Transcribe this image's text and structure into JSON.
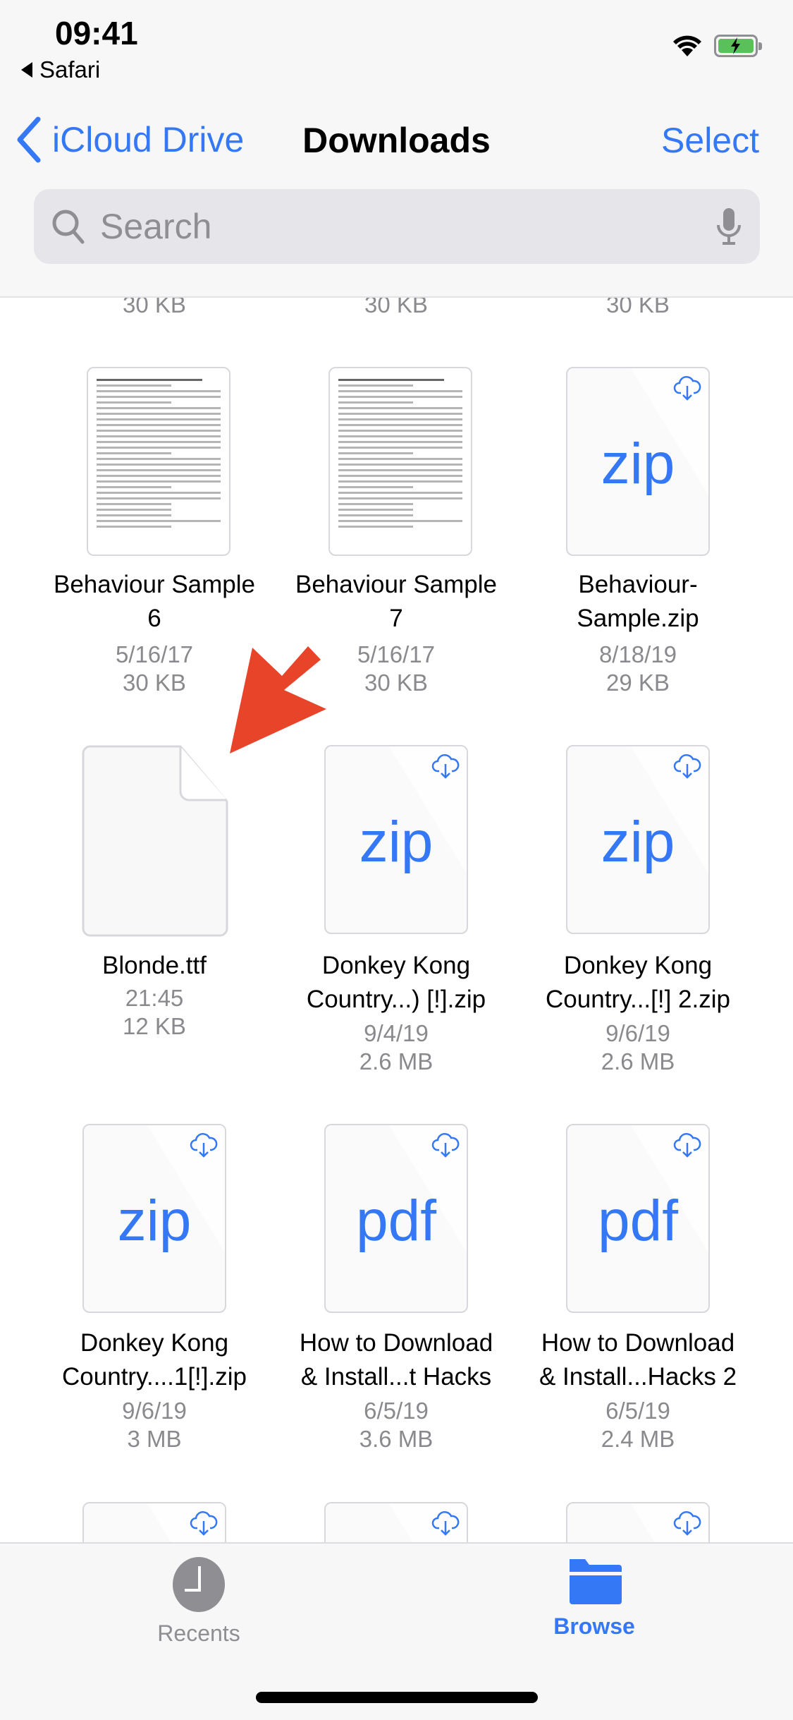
{
  "status_bar": {
    "time": "09:41",
    "back_app": "Safari"
  },
  "nav": {
    "back_label": "iCloud Drive",
    "title": "Downloads",
    "select_label": "Select"
  },
  "search": {
    "placeholder": "Search",
    "value": ""
  },
  "previous_row_sizes": [
    "30 KB",
    "30 KB",
    "30 KB"
  ],
  "files": [
    {
      "name_line1": "Behaviour Sample",
      "name_line2": "6",
      "date": "5/16/17",
      "size": "30 KB",
      "type": "document",
      "cloud": false
    },
    {
      "name_line1": "Behaviour Sample",
      "name_line2": "7",
      "date": "5/16/17",
      "size": "30 KB",
      "type": "document",
      "cloud": false
    },
    {
      "name_line1": "Behaviour-",
      "name_line2": "Sample.zip",
      "date": "8/18/19",
      "size": "29 KB",
      "type": "zip",
      "cloud": true
    },
    {
      "name_line1": "Blonde.ttf",
      "name_line2": "",
      "date": "21:45",
      "size": "12 KB",
      "type": "blank",
      "cloud": false
    },
    {
      "name_line1": "Donkey Kong",
      "name_line2": "Country...) [!].zip",
      "date": "9/4/19",
      "size": "2.6 MB",
      "type": "zip",
      "cloud": true
    },
    {
      "name_line1": "Donkey Kong",
      "name_line2": "Country...[!] 2.zip",
      "date": "9/6/19",
      "size": "2.6 MB",
      "type": "zip",
      "cloud": true
    },
    {
      "name_line1": "Donkey Kong",
      "name_line2": "Country....1[!].zip",
      "date": "9/6/19",
      "size": "3 MB",
      "type": "zip",
      "cloud": true
    },
    {
      "name_line1": "How to Download",
      "name_line2": "& Install...t Hacks",
      "date": "6/5/19",
      "size": "3.6 MB",
      "type": "pdf",
      "cloud": true
    },
    {
      "name_line1": "How to Download",
      "name_line2": "& Install...Hacks 2",
      "date": "6/5/19",
      "size": "2.4 MB",
      "type": "pdf",
      "cloud": true
    }
  ],
  "type_labels": {
    "zip": "zip",
    "pdf": "pdf"
  },
  "tabbar": {
    "recents_label": "Recents",
    "browse_label": "Browse",
    "active": "Browse"
  },
  "colors": {
    "accent": "#3478f6",
    "annotation_arrow": "#e8442a",
    "secondary_text": "#8a8a8e"
  }
}
